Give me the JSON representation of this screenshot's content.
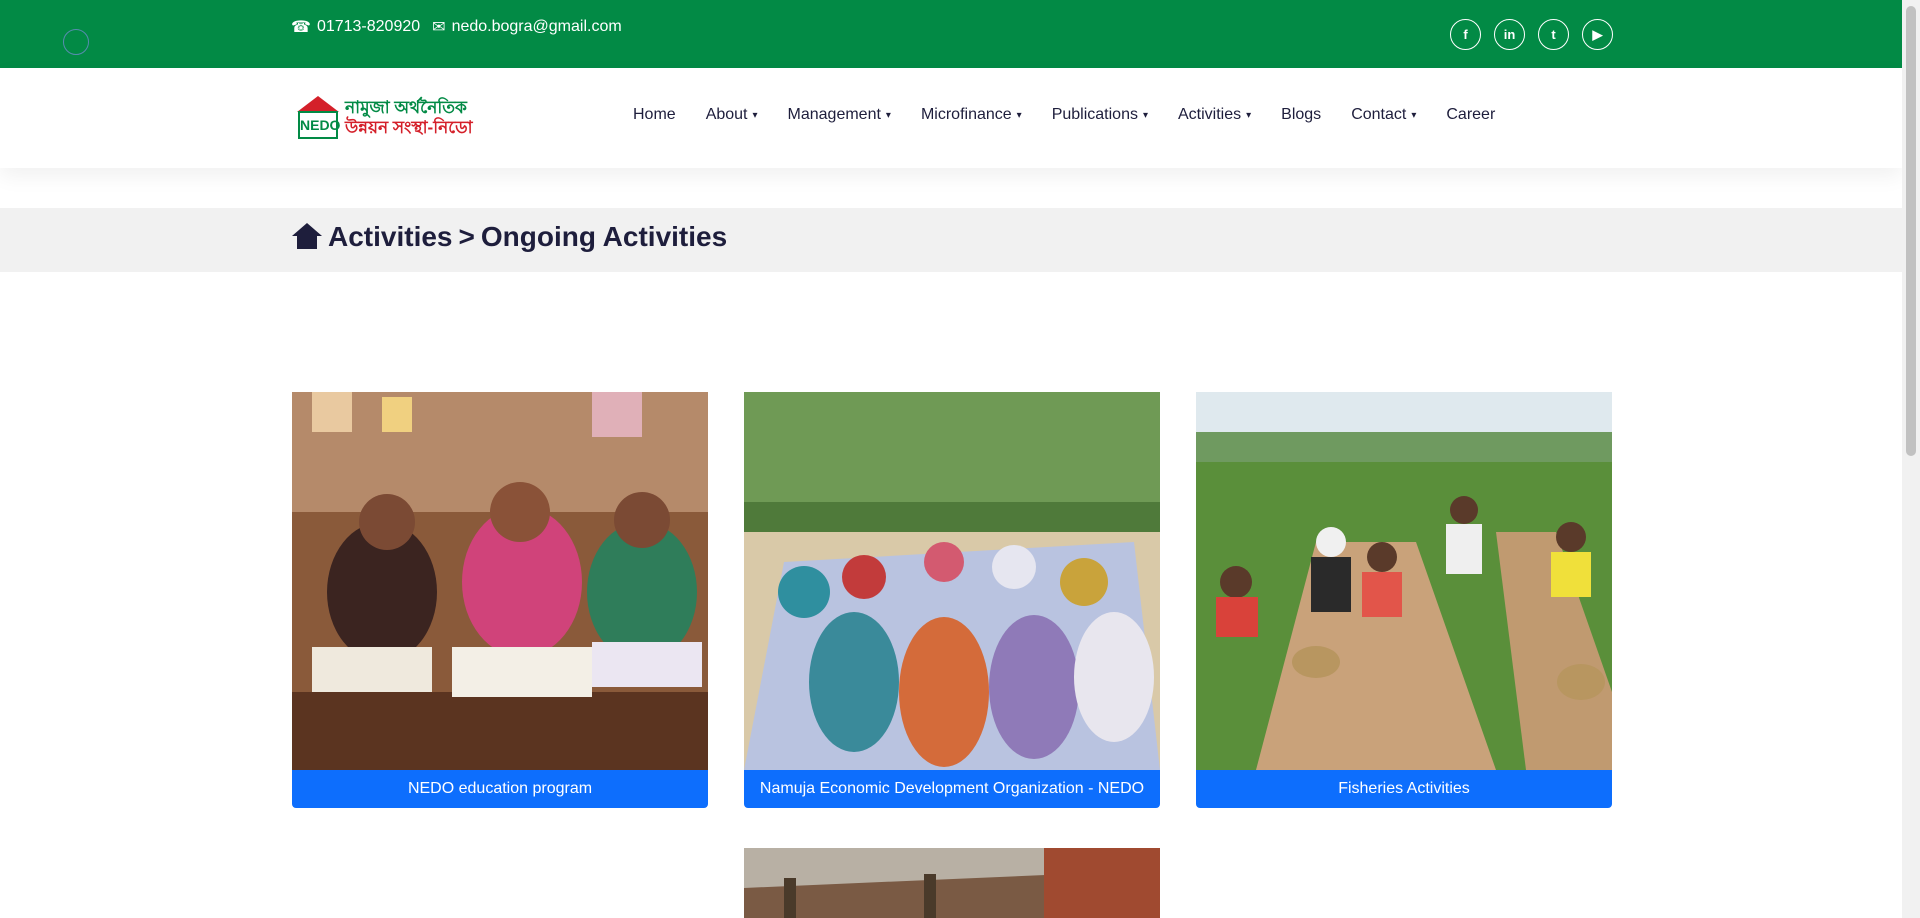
{
  "topbar": {
    "phone": "01713-820920",
    "email": "nedo.bogra@gmail.com",
    "social": [
      "f",
      "in",
      "t",
      "▶"
    ],
    "social_names": [
      "facebook-icon",
      "linkedin-icon",
      "twitter-icon",
      "youtube-icon"
    ]
  },
  "logo": {
    "mark": "NEDO",
    "line1": "নামুজা অর্থনৈতিক",
    "line2": "উন্নয়ন সংস্থা-নিডো"
  },
  "nav": {
    "items": [
      {
        "label": "Home",
        "dropdown": false
      },
      {
        "label": "About",
        "dropdown": true
      },
      {
        "label": "Management",
        "dropdown": true
      },
      {
        "label": "Microfinance",
        "dropdown": true
      },
      {
        "label": "Publications",
        "dropdown": true
      },
      {
        "label": "Activities",
        "dropdown": true
      },
      {
        "label": "Blogs",
        "dropdown": false
      },
      {
        "label": "Contact",
        "dropdown": true
      },
      {
        "label": "Career",
        "dropdown": false
      }
    ]
  },
  "breadcrumb": {
    "parent": "Activities",
    "separator": ">",
    "current": "Ongoing Activities"
  },
  "cards": [
    {
      "title": "NEDO education program"
    },
    {
      "title": "Namuja Economic Development Organization - NEDO"
    },
    {
      "title": "Fisheries Activities"
    },
    {
      "title": ""
    }
  ],
  "colors": {
    "topbar": "#028a45",
    "button": "#0d6efd",
    "text": "#1e1e3c"
  }
}
